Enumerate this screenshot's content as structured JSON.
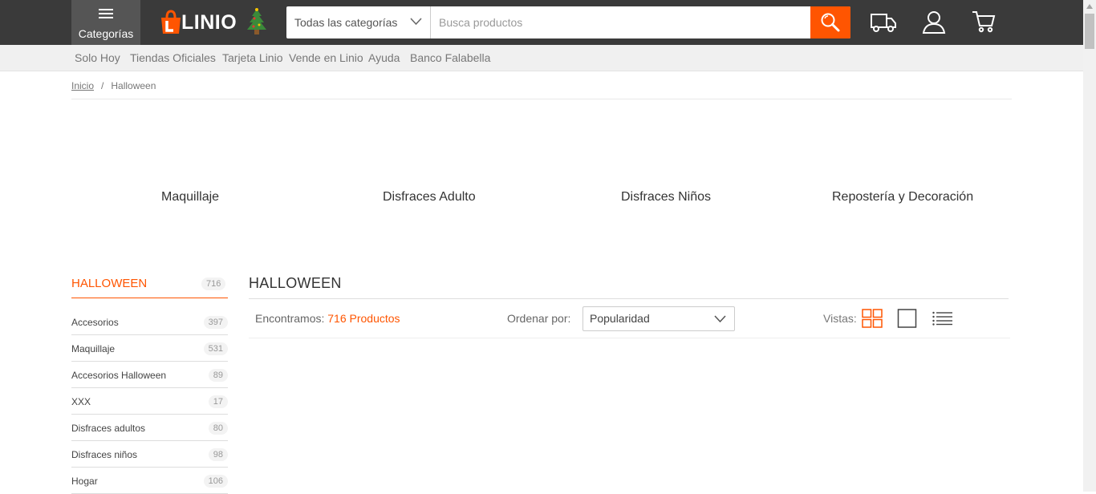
{
  "header": {
    "categories_label": "Categorías",
    "logo_text": "LINIO",
    "search_category": "Todas las categorías",
    "search_placeholder": "Busca productos"
  },
  "subnav": [
    "Solo Hoy",
    "Tiendas Oficiales",
    "Tarjeta Linio",
    "Vende en Linio",
    "Ayuda",
    "Banco Falabella"
  ],
  "breadcrumb": {
    "home": "Inicio",
    "separator": "/",
    "current": "Halloween"
  },
  "featured": [
    "Maquillaje",
    "Disfraces Adulto",
    "Disfraces Niños",
    "Repostería y Decoración"
  ],
  "sidebar": {
    "title": "HALLOWEEN",
    "title_count": "716",
    "items": [
      {
        "label": "Accesorios",
        "count": "397"
      },
      {
        "label": "Maquillaje",
        "count": "531"
      },
      {
        "label": "Accesorios Halloween",
        "count": "89"
      },
      {
        "label": "XXX",
        "count": "17"
      },
      {
        "label": "Disfraces adultos",
        "count": "80"
      },
      {
        "label": "Disfraces niños",
        "count": "98"
      },
      {
        "label": "Hogar",
        "count": "106"
      }
    ]
  },
  "main": {
    "title": "HALLOWEEN",
    "found_prefix": "Encontramos:",
    "found_count": "716 Productos",
    "order_label": "Ordenar por:",
    "order_value": "Popularidad",
    "views_label": "Vistas:"
  },
  "colors": {
    "accent": "#ff5501",
    "header_bg": "#3a3a3a"
  }
}
